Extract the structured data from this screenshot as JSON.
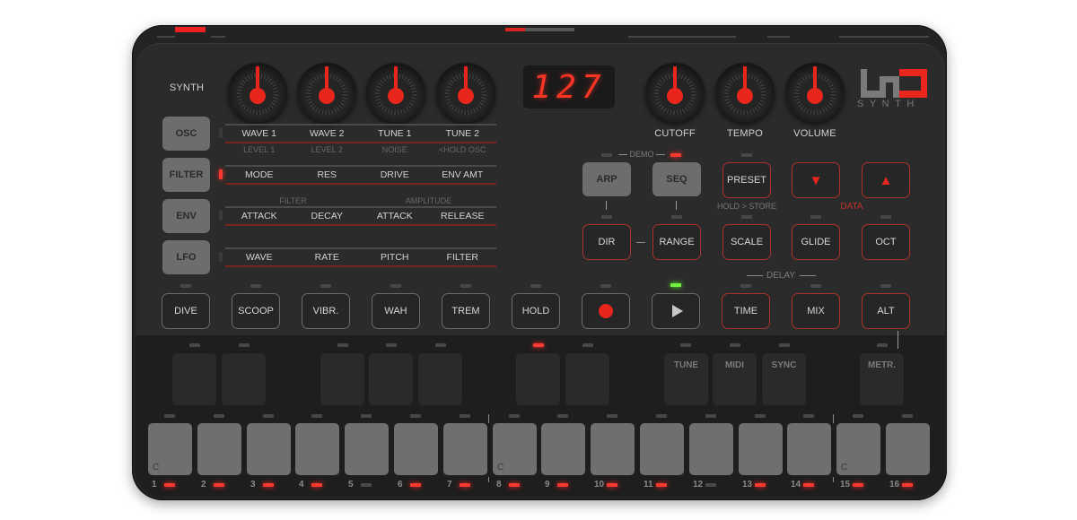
{
  "synth_label": "SYNTH",
  "display": {
    "value": "127"
  },
  "logo": {
    "mark": "UNO",
    "subtitle": "SYNTH",
    "colors": {
      "grey": "#7a7a7a",
      "red": "#e8261b"
    }
  },
  "knobs": [
    {
      "name": "wave-1",
      "position": 0.5
    },
    {
      "name": "wave-2",
      "position": 0.5
    },
    {
      "name": "tune-1",
      "position": 0.5
    },
    {
      "name": "tune-2",
      "position": 0.5
    },
    {
      "name": "cutoff",
      "label": "CUTOFF",
      "position": 0.5
    },
    {
      "name": "tempo",
      "label": "TEMPO",
      "position": 0.5
    },
    {
      "name": "volume",
      "label": "VOLUME",
      "position": 0.5
    }
  ],
  "modes": [
    {
      "label": "OSC",
      "active": false
    },
    {
      "label": "FILTER",
      "active": true
    },
    {
      "label": "ENV",
      "active": false
    },
    {
      "label": "LFO",
      "active": false
    }
  ],
  "param_rows": [
    {
      "params": [
        "WAVE 1",
        "WAVE 2",
        "TUNE 1",
        "TUNE 2"
      ],
      "sub": [
        "LEVEL 1",
        "LEVEL 2",
        "NOISE",
        "<HOLD OSC"
      ]
    },
    {
      "params": [
        "MODE",
        "RES",
        "DRIVE",
        "ENV AMT"
      ]
    },
    {
      "headers": [
        "FILTER",
        "AMPLITUDE"
      ],
      "params": [
        "ATTACK",
        "DECAY",
        "ATTACK",
        "RELEASE"
      ]
    },
    {
      "params": [
        "WAVE",
        "RATE",
        "PITCH",
        "FILTER"
      ]
    }
  ],
  "demo_label": "DEMO",
  "arp_seq": {
    "arp": "ARP",
    "seq": "SEQ"
  },
  "preset": {
    "label": "PRESET",
    "hint": "HOLD > STORE"
  },
  "data": {
    "label": "DATA",
    "down": "▼",
    "up": "▲"
  },
  "row2": {
    "dir": "DIR",
    "range": "RANGE",
    "scale": "SCALE",
    "glide": "GLIDE",
    "oct": "OCT"
  },
  "delay": {
    "label": "DELAY",
    "time": "TIME",
    "mix": "MIX",
    "alt": "ALT"
  },
  "performance": [
    "DIVE",
    "SCOOP",
    "VIBR.",
    "WAH",
    "TREM",
    "HOLD"
  ],
  "transport": {
    "record": "record",
    "play": "play",
    "play_led": "on"
  },
  "black_pads": [
    "",
    "",
    "",
    "",
    "",
    "",
    "",
    "TUNE",
    "MIDI",
    "SYNC",
    "METR."
  ],
  "step_pads": {
    "notes": {
      "1": "C",
      "8": "C",
      "15": "C"
    },
    "numbers": [
      "1",
      "2",
      "3",
      "4",
      "5",
      "6",
      "7",
      "8",
      "9",
      "10",
      "11",
      "12",
      "13",
      "14",
      "15",
      "16"
    ],
    "leds_on": [
      true,
      true,
      true,
      true,
      false,
      true,
      true,
      true,
      true,
      true,
      true,
      false,
      true,
      true,
      true,
      true
    ]
  },
  "colors": {
    "accent_red": "#e8261b",
    "led_green": "#74f040",
    "panel": "#2b2b2b"
  }
}
